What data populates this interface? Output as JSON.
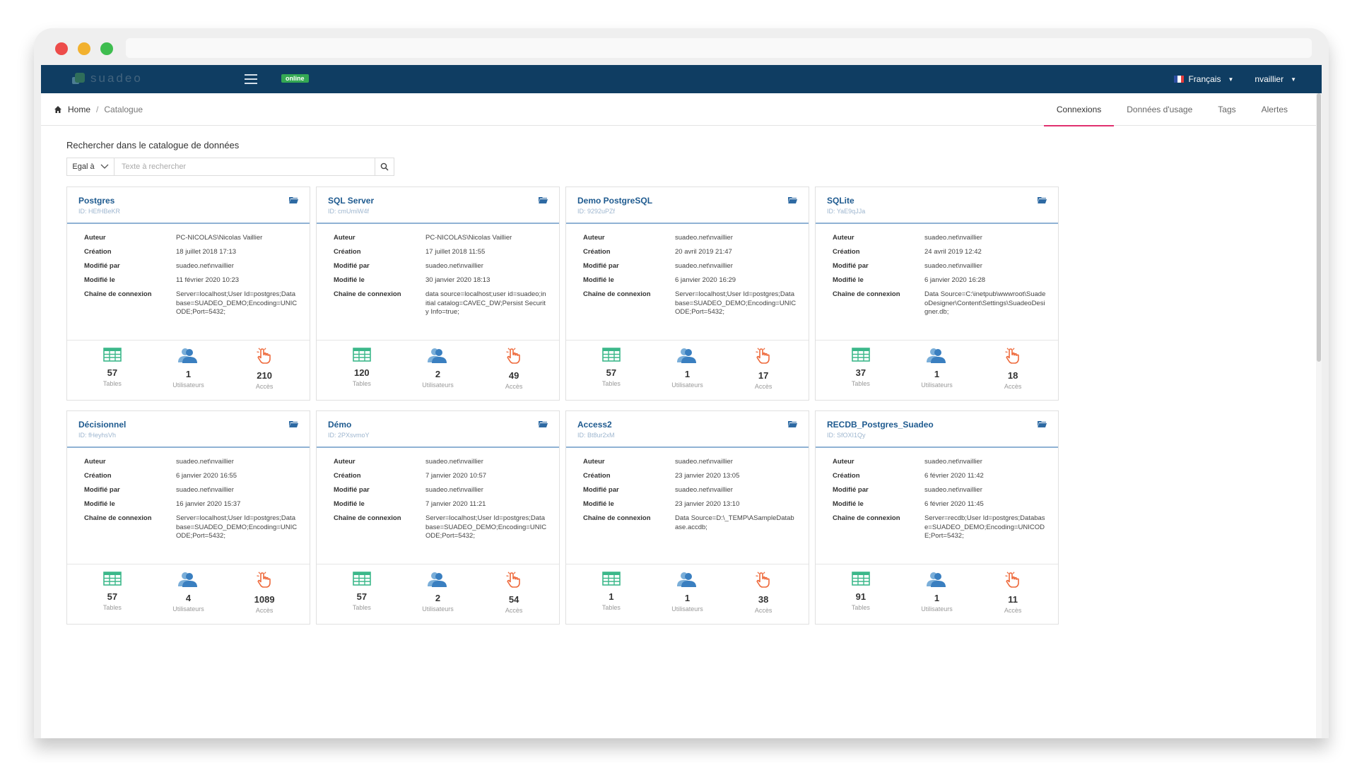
{
  "app": {
    "logo_text": "suadeo",
    "status_badge": "online"
  },
  "nav": {
    "language": "Français",
    "user": "nvaillier"
  },
  "breadcrumb": {
    "home": "Home",
    "separator": "/",
    "current": "Catalogue"
  },
  "tabs": [
    {
      "label": "Connexions",
      "active": true
    },
    {
      "label": "Données d'usage",
      "active": false
    },
    {
      "label": "Tags",
      "active": false
    },
    {
      "label": "Alertes",
      "active": false
    }
  ],
  "search": {
    "title": "Rechercher dans le catalogue de données",
    "operator": "Egal à",
    "placeholder": "Texte à rechercher",
    "value": ""
  },
  "labels": {
    "auteur": "Auteur",
    "creation": "Création",
    "modifie_par": "Modifié par",
    "modifie_le": "Modifié le",
    "chaine": "Chaîne de connexion",
    "tables": "Tables",
    "utilisateurs": "Utilisateurs",
    "acces": "Accès"
  },
  "colors": {
    "navbar": "#0f3d62",
    "tab_active": "#e0306e",
    "card_title": "#1e5a8f",
    "tables_icon": "#3cb88a",
    "users_icon": "#4a8ec7",
    "access_icon": "#ee6a3c"
  },
  "icons": {
    "home": "home-icon",
    "search": "search-icon",
    "folder": "folder-icon",
    "tables": "table-grid-icon",
    "users": "users-icon",
    "access": "hand-pointer-icon",
    "menu": "hamburger-icon"
  },
  "cards": [
    {
      "title": "Postgres",
      "id": "ID: HEfHBeKR",
      "auteur": "PC-NICOLAS\\Nicolas Vaillier",
      "creation": "18 juillet 2018 17:13",
      "modifie_par": "suadeo.net\\nvaillier",
      "modifie_le": "11 février 2020 10:23",
      "chaine": "Server=localhost;User Id=postgres;Database=SUADEO_DEMO;Encoding=UNICODE;Port=5432;",
      "tables": "57",
      "utilisateurs": "1",
      "acces": "210"
    },
    {
      "title": "SQL Server",
      "id": "ID: cmUmiW4f",
      "auteur": "PC-NICOLAS\\Nicolas Vaillier",
      "creation": "17 juillet 2018 11:55",
      "modifie_par": "suadeo.net\\nvaillier",
      "modifie_le": "30 janvier 2020 18:13",
      "chaine": "data source=localhost;user id=suadeo;initial catalog=CAVEC_DW;Persist Security Info=true;",
      "tables": "120",
      "utilisateurs": "2",
      "acces": "49"
    },
    {
      "title": "Demo PostgreSQL",
      "id": "ID: 9292uPZf",
      "auteur": "suadeo.net\\nvaillier",
      "creation": "20 avril 2019 21:47",
      "modifie_par": "suadeo.net\\nvaillier",
      "modifie_le": "6 janvier 2020 16:29",
      "chaine": "Server=localhost;User Id=postgres;Database=SUADEO_DEMO;Encoding=UNICODE;Port=5432;",
      "tables": "57",
      "utilisateurs": "1",
      "acces": "17"
    },
    {
      "title": "SQLite",
      "id": "ID: YaE9qJJa",
      "auteur": "suadeo.net\\nvaillier",
      "creation": "24 avril 2019 12:42",
      "modifie_par": "suadeo.net\\nvaillier",
      "modifie_le": "6 janvier 2020 16:28",
      "chaine": "Data Source=C:\\inetpub\\wwwroot\\SuadeoDesigner\\Content\\Settings\\SuadeoDesigner.db;",
      "tables": "37",
      "utilisateurs": "1",
      "acces": "18"
    },
    {
      "title": "Décisionnel",
      "id": "ID: fHeyhsVh",
      "auteur": "suadeo.net\\nvaillier",
      "creation": "6 janvier 2020 16:55",
      "modifie_par": "suadeo.net\\nvaillier",
      "modifie_le": "16 janvier 2020 15:37",
      "chaine": "Server=localhost;User Id=postgres;Database=SUADEO_DEMO;Encoding=UNICODE;Port=5432;",
      "tables": "57",
      "utilisateurs": "4",
      "acces": "1089"
    },
    {
      "title": "Démo",
      "id": "ID: 2PXsvmoY",
      "auteur": "suadeo.net\\nvaillier",
      "creation": "7 janvier 2020 10:57",
      "modifie_par": "suadeo.net\\nvaillier",
      "modifie_le": "7 janvier 2020 11:21",
      "chaine": "Server=localhost;User Id=postgres;Database=SUADEO_DEMO;Encoding=UNICODE;Port=5432;",
      "tables": "57",
      "utilisateurs": "2",
      "acces": "54"
    },
    {
      "title": "Access2",
      "id": "ID: Bt8ur2xM",
      "auteur": "suadeo.net\\nvaillier",
      "creation": "23 janvier 2020 13:05",
      "modifie_par": "suadeo.net\\nvaillier",
      "modifie_le": "23 janvier 2020 13:10",
      "chaine": "Data Source=D:\\_TEMP\\ASampleDatabase.accdb;",
      "tables": "1",
      "utilisateurs": "1",
      "acces": "38"
    },
    {
      "title": "RECDB_Postgres_Suadeo",
      "id": "ID: SfOXI1Qy",
      "auteur": "suadeo.net\\nvaillier",
      "creation": "6 février 2020 11:42",
      "modifie_par": "suadeo.net\\nvaillier",
      "modifie_le": "6 février 2020 11:45",
      "chaine": "Server=recdb;User Id=postgres;Database=SUADEO_DEMO;Encoding=UNICODE;Port=5432;",
      "tables": "91",
      "utilisateurs": "1",
      "acces": "11"
    }
  ]
}
